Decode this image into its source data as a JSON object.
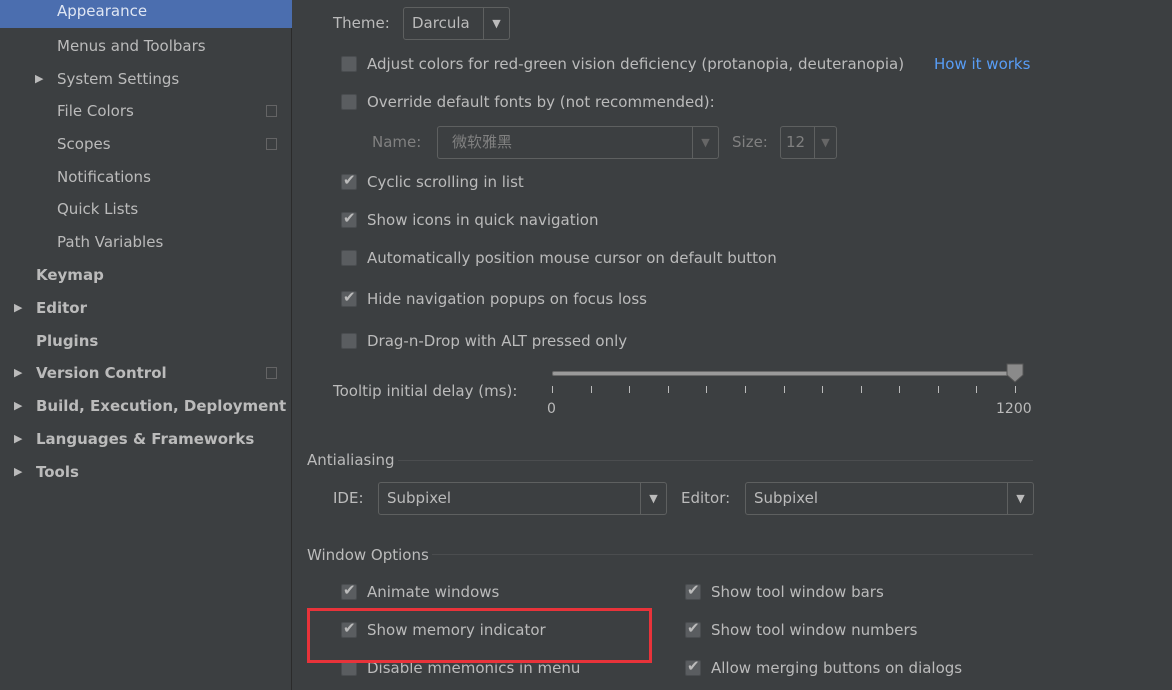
{
  "sidebar": {
    "items": [
      {
        "label": "Appearance",
        "selected": true
      },
      {
        "label": "Menus and Toolbars"
      },
      {
        "label": "System Settings",
        "expandable": true
      },
      {
        "label": "File Colors",
        "icon": "copy-icon"
      },
      {
        "label": "Scopes",
        "icon": "copy-icon"
      },
      {
        "label": "Notifications"
      },
      {
        "label": "Quick Lists"
      },
      {
        "label": "Path Variables"
      },
      {
        "label": "Keymap"
      },
      {
        "label": "Editor",
        "expandable": true
      },
      {
        "label": "Plugins"
      },
      {
        "label": "Version Control",
        "expandable": true,
        "icon": "copy-icon"
      },
      {
        "label": "Build, Execution, Deployment",
        "expandable": true
      },
      {
        "label": "Languages & Frameworks",
        "expandable": true
      },
      {
        "label": "Tools",
        "expandable": true
      }
    ]
  },
  "ui": {
    "theme_label": "Theme:",
    "theme_value": "Darcula",
    "adjust_colors": {
      "label": "Adjust colors for red-green vision deficiency (protanopia, deuteranopia)",
      "checked": false
    },
    "how_it_works": "How it works",
    "override_fonts": {
      "label": "Override default fonts by (not recommended):",
      "checked": false
    },
    "font_name_label": "Name:",
    "font_name_value": "微软雅黑",
    "font_size_label": "Size:",
    "font_size_value": "12",
    "cyclic": {
      "label": "Cyclic scrolling in list",
      "checked": true
    },
    "show_icons": {
      "label": "Show icons in quick navigation",
      "checked": true
    },
    "auto_mouse": {
      "label": "Automatically position mouse cursor on default button",
      "checked": false
    },
    "hide_popups": {
      "label": "Hide navigation popups on focus loss",
      "checked": true
    },
    "dnd_alt": {
      "label": "Drag-n-Drop with ALT pressed only",
      "checked": false
    },
    "tooltip": {
      "label": "Tooltip initial delay (ms):",
      "min": "0",
      "max": "1200",
      "value": 1200
    }
  },
  "antialiasing": {
    "title": "Antialiasing",
    "ide_label": "IDE:",
    "ide_value": "Subpixel",
    "editor_label": "Editor:",
    "editor_value": "Subpixel"
  },
  "window_options": {
    "title": "Window Options",
    "animate": {
      "label": "Animate windows",
      "checked": true
    },
    "memory": {
      "label": "Show memory indicator",
      "checked": true
    },
    "mnemonics": {
      "label": "Disable mnemonics in menu",
      "checked": false
    },
    "tool_bars": {
      "label": "Show tool window bars",
      "checked": true
    },
    "tool_numbers": {
      "label": "Show tool window numbers",
      "checked": true
    },
    "merge_buttons": {
      "label": "Allow merging buttons on dialogs",
      "checked": true
    }
  },
  "colors": {
    "selection": "#4b6eaf",
    "link": "#589df6",
    "highlight": "#e8333a",
    "background": "#3c3f41"
  }
}
